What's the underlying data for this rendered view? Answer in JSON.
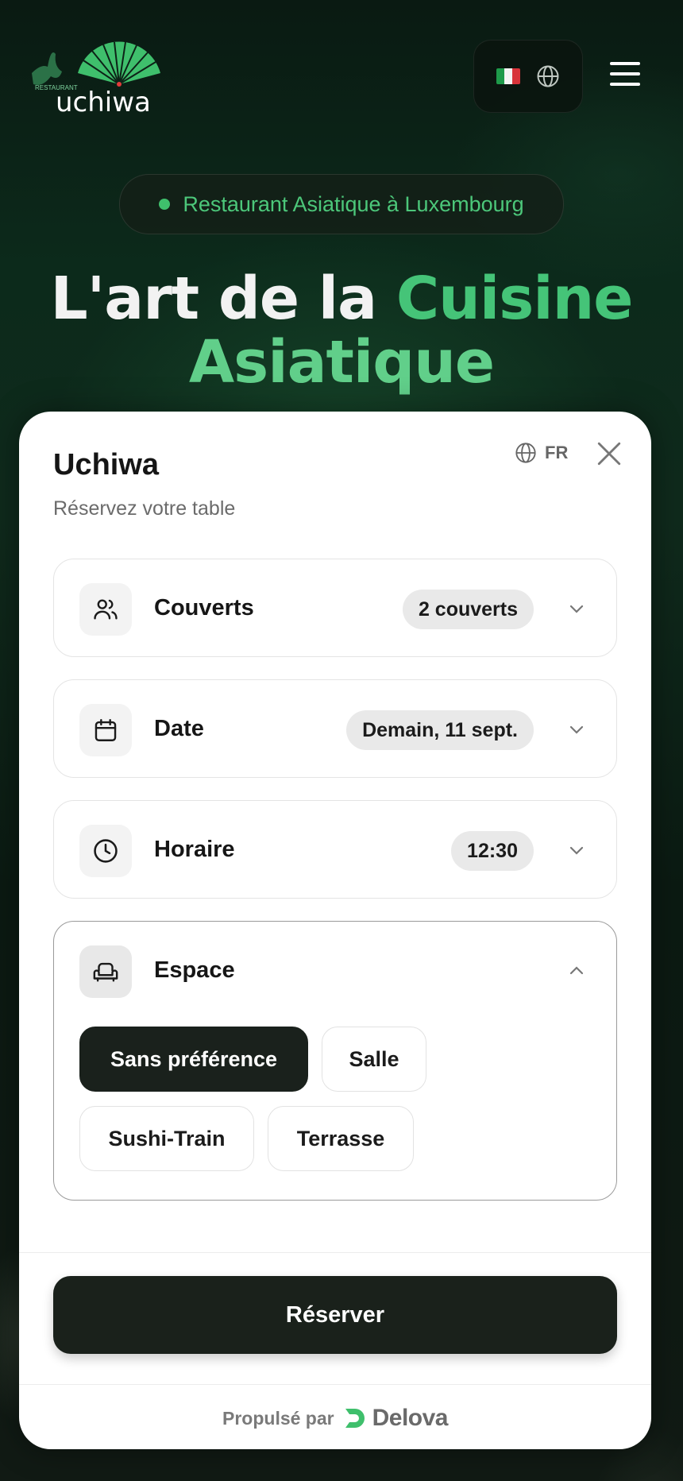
{
  "header": {
    "logo_small_text": "RESTAURANT",
    "logo_text": "uchiwa",
    "menu_icon": "hamburger-icon",
    "flag_icon": "italy-flag-icon",
    "globe_icon": "globe-icon"
  },
  "hero": {
    "badge": "Restaurant Asiatique à Luxembourg",
    "title_part1": "L'art de la ",
    "title_part2": "Cuisine",
    "title_part3": "Asiatique"
  },
  "modal": {
    "title": "Uchiwa",
    "subtitle": "Réservez votre table",
    "lang": "FR",
    "sections": [
      {
        "label": "Couverts",
        "value": "2 couverts",
        "icon": "users-icon"
      },
      {
        "label": "Date",
        "value": "Demain, 11 sept.",
        "icon": "calendar-icon"
      },
      {
        "label": "Horaire",
        "value": "12:30",
        "icon": "clock-icon"
      },
      {
        "label": "Espace",
        "icon": "armchair-icon"
      }
    ],
    "espace_options": [
      "Sans préférence",
      "Salle",
      "Sushi-Train",
      "Terrasse"
    ],
    "selected_option": "Sans préférence",
    "reserve_button": "Réserver",
    "powered_by": "Propulsé par",
    "brand": "Delova"
  },
  "colors": {
    "accent_green": "#45c478",
    "button_dark": "#1a211b",
    "page_dark": "#0c2a1b"
  }
}
